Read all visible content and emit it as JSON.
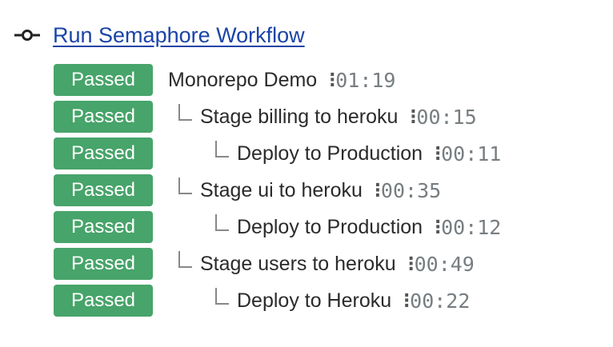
{
  "workflow": {
    "icon": "commit-icon",
    "title": "Run Semaphore Workflow",
    "link_color": "#1a44a8"
  },
  "status_color": "#47a46a",
  "rows": [
    {
      "status": "Passed",
      "name": "Monorepo Demo",
      "duration": "01:19",
      "level": 0
    },
    {
      "status": "Passed",
      "name": "Stage billing to heroku",
      "duration": "00:15",
      "level": 1
    },
    {
      "status": "Passed",
      "name": "Deploy to Production",
      "duration": "00:11",
      "level": 2
    },
    {
      "status": "Passed",
      "name": "Stage ui to heroku",
      "duration": "00:35",
      "level": 1
    },
    {
      "status": "Passed",
      "name": "Deploy to Production",
      "duration": "00:12",
      "level": 2
    },
    {
      "status": "Passed",
      "name": "Stage users to heroku",
      "duration": "00:49",
      "level": 1
    },
    {
      "status": "Passed",
      "name": "Deploy to Heroku",
      "duration": "00:22",
      "level": 2
    }
  ]
}
